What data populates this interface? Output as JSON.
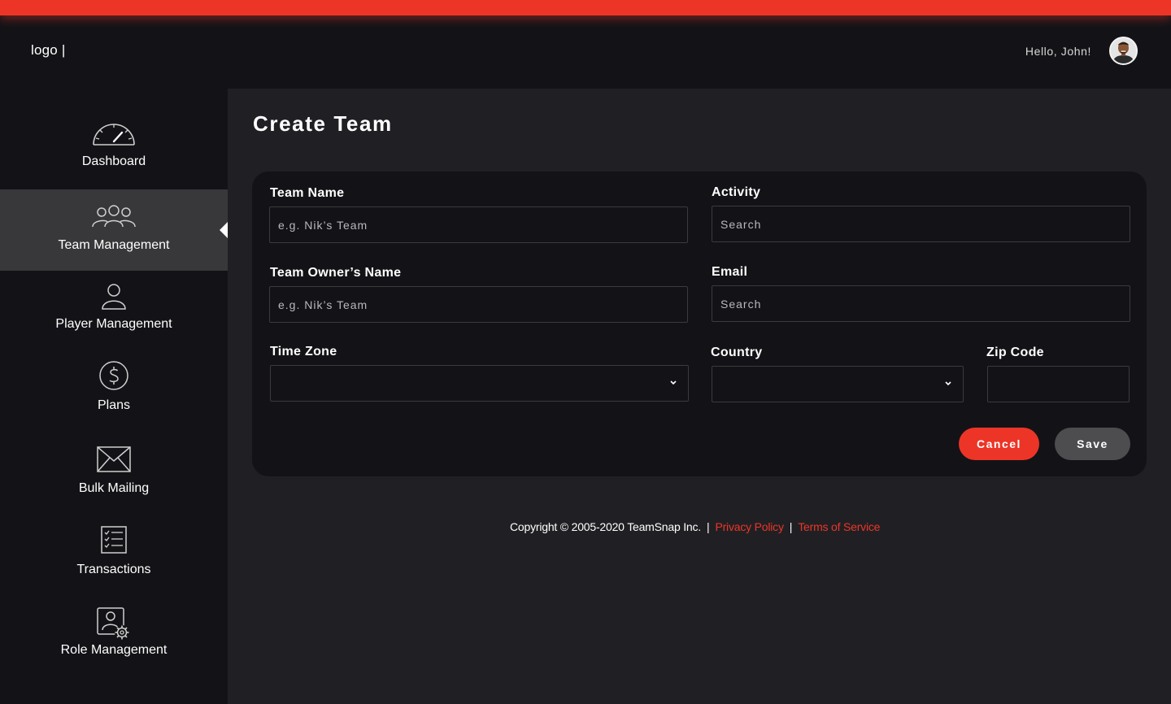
{
  "header": {
    "logo_text": "logo |",
    "greeting": "Hello, John!"
  },
  "sidebar": {
    "items": [
      {
        "label": "Dashboard",
        "icon": "speedometer-icon",
        "active": false
      },
      {
        "label": "Team Management",
        "icon": "team-icon",
        "active": true
      },
      {
        "label": "Player Management",
        "icon": "person-icon",
        "active": false
      },
      {
        "label": "Plans",
        "icon": "dollar-circle-icon",
        "active": false
      },
      {
        "label": "Bulk Mailing",
        "icon": "envelope-icon",
        "active": false
      },
      {
        "label": "Transactions",
        "icon": "checklist-icon",
        "active": false
      },
      {
        "label": "Role Management",
        "icon": "user-gear-icon",
        "active": false
      }
    ]
  },
  "main": {
    "title": "Create Team"
  },
  "form": {
    "team_name": {
      "label": "Team Name",
      "placeholder": "e.g. Nik’s Team",
      "value": ""
    },
    "activity": {
      "label": "Activity",
      "placeholder": "Search",
      "value": ""
    },
    "owner_name": {
      "label": "Team Owner’s Name",
      "placeholder": "e.g. Nik’s Team",
      "value": ""
    },
    "email": {
      "label": "Email",
      "placeholder": "Search",
      "value": ""
    },
    "time_zone": {
      "label": "Time Zone",
      "value": ""
    },
    "country": {
      "label": "Country",
      "value": ""
    },
    "zip_code": {
      "label": "Zip Code",
      "value": ""
    },
    "cancel_label": "Cancel",
    "save_label": "Save"
  },
  "footer": {
    "copyright": "Copyright © 2005-2020 TeamSnap Inc.",
    "separator": "|",
    "privacy_link": "Privacy Policy",
    "terms_link": "Terms of Service"
  },
  "colors": {
    "accent": "#ec3527",
    "background": "#202024",
    "panel": "#131317",
    "active_nav": "#38383b",
    "secondary_button": "#4d4d50"
  }
}
